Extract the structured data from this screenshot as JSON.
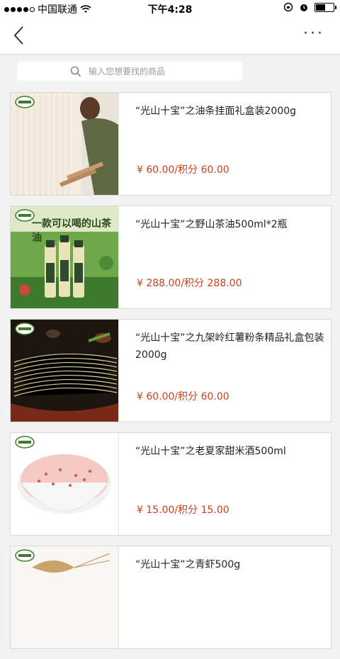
{
  "status": {
    "carrier": "中国联通",
    "time": "下午4:28",
    "battery_level": 0.5
  },
  "nav": {
    "back_icon": "chevron-left-icon",
    "more_label": "···"
  },
  "search": {
    "placeholder": "输入您想要找的商品",
    "icon": "search-icon"
  },
  "products": [
    {
      "title": "“光山十宝”之油条挂面礼盒装2000g",
      "price": "¥ 60.00/积分 60.00"
    },
    {
      "title": "“光山十宝”之野山茶油500ml*2瓶",
      "price": "¥ 288.00/积分 288.00"
    },
    {
      "title": "“光山十宝”之九架岭红薯粉条精品礼盒包装2000g",
      "price": "¥ 60.00/积分 60.00"
    },
    {
      "title": "“光山十宝”之老夏家甜米酒500ml",
      "price": "¥ 15.00/积分 15.00"
    },
    {
      "title": "“光山十宝”之青虾500g",
      "price": ""
    }
  ],
  "images": {
    "banner_text": "一款可以喝的山茶油"
  },
  "colors": {
    "price": "#c9421d",
    "background": "#f2f2f2"
  }
}
